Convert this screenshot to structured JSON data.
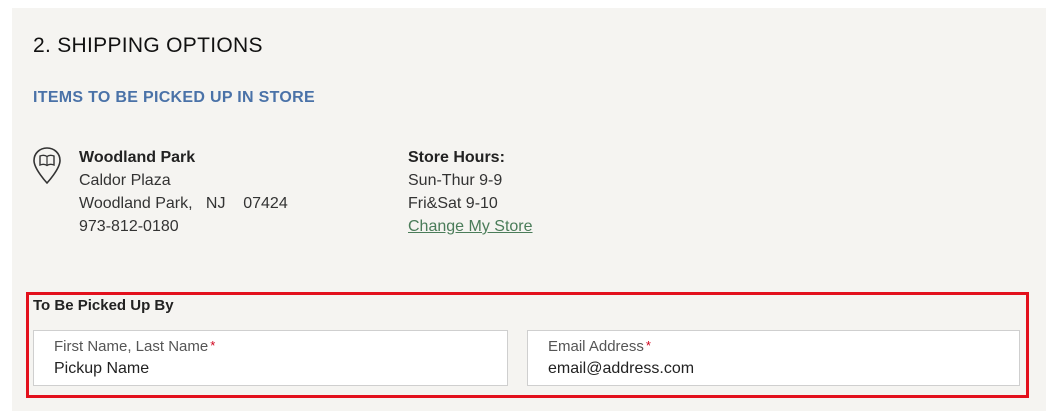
{
  "shipping": {
    "section_title": "2. SHIPPING OPTIONS",
    "subtitle": "ITEMS TO BE PICKED UP IN STORE"
  },
  "store": {
    "icon": "store-location-pin-icon",
    "name": "Woodland Park",
    "address_line1": "Caldor Plaza",
    "city": "Woodland Park,",
    "state": "NJ",
    "zip": "07424",
    "phone": "973-812-0180"
  },
  "hours": {
    "title": "Store Hours:",
    "line1": "Sun-Thur 9-9",
    "line2": "Fri&Sat 9-10",
    "change_link": "Change My Store"
  },
  "pickup": {
    "label": "To Be Picked Up By",
    "name_field": {
      "label": "First Name, Last Name",
      "required_mark": "*",
      "value": "Pickup Name"
    },
    "email_field": {
      "label": "Email Address",
      "required_mark": "*",
      "value": "email@address.com"
    }
  },
  "colors": {
    "accent_blue": "#4a72a8",
    "link_green": "#4a7c59",
    "highlight_red": "#e3101c",
    "panel_bg": "#f5f4f1"
  }
}
